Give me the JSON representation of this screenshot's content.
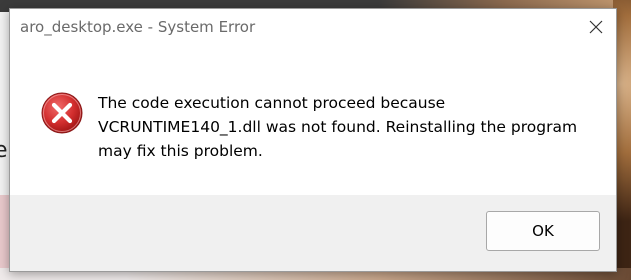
{
  "window": {
    "title": "aro_desktop.exe - System Error"
  },
  "message": {
    "lines": [
      "The code execution cannot proceed because",
      "VCRUNTIME140_1.dll was not found. Reinstalling the program",
      "may fix this problem."
    ]
  },
  "buttons": {
    "ok_label": "OK"
  },
  "background": {
    "left_glyph": "e"
  },
  "icons": {
    "error": "error-icon",
    "close": "close-icon"
  },
  "colors": {
    "error_red": "#d32f2f",
    "footer_bg": "#f0f0f0",
    "title_text": "#6a6a6a"
  }
}
